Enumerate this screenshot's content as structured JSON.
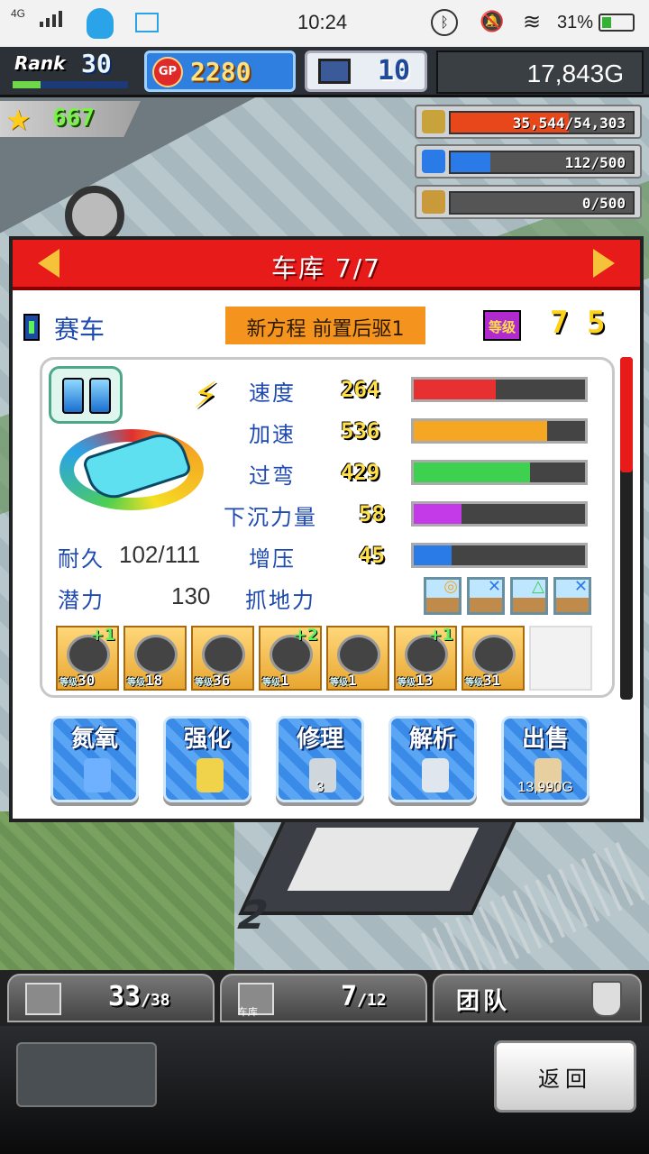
{
  "status_bar": {
    "network": "4G",
    "time": "10:24",
    "battery": "31%"
  },
  "hud": {
    "rank_label": "Rank",
    "rank_value": "30",
    "gp_badge": "GP",
    "gp_value": "2280",
    "pc_value": "10",
    "money": "17,843G",
    "star_value": "667"
  },
  "resources": [
    {
      "icon": "coin-stack-icon",
      "text": "35,544/54,303",
      "fraction": 0.65,
      "color": "#e8461b"
    },
    {
      "icon": "fuel-can-icon",
      "text": "112/500",
      "fraction": 0.22,
      "color": "#2a7ae8"
    },
    {
      "icon": "wheat-icon",
      "text": "0/500",
      "fraction": 0.0,
      "color": "#9bd04a"
    }
  ],
  "panel": {
    "title": "车库 7/7",
    "car_category": "赛车",
    "car_name": "新方程 前置后驱1",
    "level_badge": "等级",
    "level_value": "7 5"
  },
  "stats": [
    {
      "label": "速度",
      "value": "264",
      "fraction": 0.48,
      "color": "#e83030"
    },
    {
      "label": "加速",
      "value": "536",
      "fraction": 0.78,
      "color": "#f5a623"
    },
    {
      "label": "过弯",
      "value": "429",
      "fraction": 0.68,
      "color": "#3ed04f"
    },
    {
      "label": "下沉力量",
      "value": "58",
      "fraction": 0.28,
      "color": "#c43ae8"
    },
    {
      "label": "增压",
      "value": "45",
      "fraction": 0.22,
      "color": "#2a7ae8"
    }
  ],
  "extras": {
    "durability_label": "耐久",
    "durability_value": "102/111",
    "potential_label": "潜力",
    "potential_value": "130",
    "grip_label": "抓地力"
  },
  "terrain_icons": [
    {
      "name": "terrain-sunny-icon",
      "mark": "◎",
      "mark_color": "#f5a623"
    },
    {
      "name": "terrain-desert-icon",
      "mark": "✕",
      "mark_color": "#2a7ae8"
    },
    {
      "name": "terrain-rock-icon",
      "mark": "△",
      "mark_color": "#3ed04f"
    },
    {
      "name": "terrain-snow-icon",
      "mark": "✕",
      "mark_color": "#2a7ae8"
    }
  ],
  "parts": [
    {
      "name": "engine-part-icon",
      "plus": "+1",
      "level": "30"
    },
    {
      "name": "tire-part-icon",
      "plus": "",
      "level": "18"
    },
    {
      "name": "wheel-part-icon",
      "plus": "",
      "level": "36"
    },
    {
      "name": "supercharger-part-icon",
      "plus": "+2",
      "level": "1"
    },
    {
      "name": "chip-part-icon",
      "plus": "",
      "level": "1"
    },
    {
      "name": "turbo-part-icon",
      "plus": "+1",
      "level": "13"
    },
    {
      "name": "suspension-part-icon",
      "plus": "",
      "level": "31"
    }
  ],
  "part_level_prefix": "等级",
  "actions": [
    {
      "name": "nitro-button",
      "label": "氮氧",
      "sub": ""
    },
    {
      "name": "upgrade-button",
      "label": "强化",
      "sub": ""
    },
    {
      "name": "repair-button",
      "label": "修理",
      "sub": "3"
    },
    {
      "name": "analyze-button",
      "label": "解析",
      "sub": ""
    },
    {
      "name": "sell-button",
      "label": "出售",
      "sub": "13,990G"
    }
  ],
  "bottom_tabs": {
    "parts_count": "33",
    "parts_total": "/38",
    "garage_count": "7",
    "garage_total": "/12",
    "garage_label": "车库",
    "team_label": "团队"
  },
  "back_button": "返回"
}
